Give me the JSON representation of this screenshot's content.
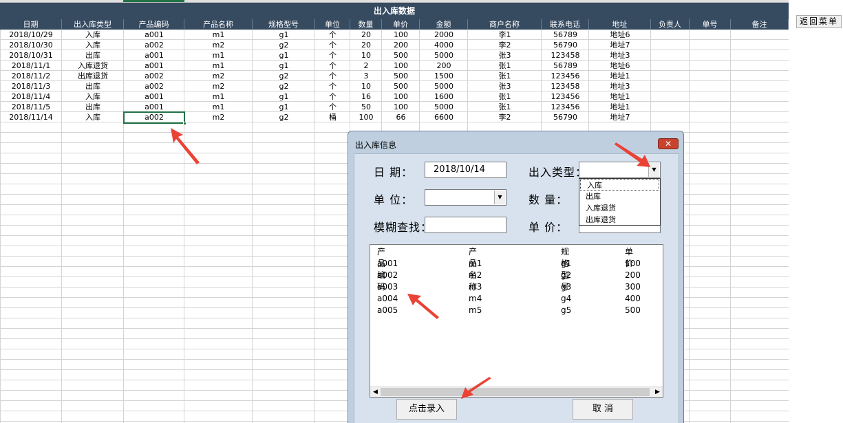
{
  "sheet": {
    "title": "出入库数据",
    "columns": [
      "日期",
      "出入库类型",
      "产品编码",
      "产品名称",
      "规格型号",
      "单位",
      "数量",
      "单价",
      "金额",
      "商户名称",
      "联系电话",
      "地址",
      "负责人",
      "单号",
      "备注"
    ],
    "rows": [
      [
        "2018/10/29",
        "入库",
        "a001",
        "m1",
        "g1",
        "个",
        "20",
        "100",
        "2000",
        "李1",
        "56789",
        "地址6",
        "",
        "",
        ""
      ],
      [
        "2018/10/30",
        "入库",
        "a002",
        "m2",
        "g2",
        "个",
        "20",
        "200",
        "4000",
        "李2",
        "56790",
        "地址7",
        "",
        "",
        ""
      ],
      [
        "2018/10/31",
        "出库",
        "a001",
        "m1",
        "g1",
        "个",
        "10",
        "500",
        "5000",
        "张3",
        "123458",
        "地址3",
        "",
        "",
        ""
      ],
      [
        "2018/11/1",
        "入库退货",
        "a001",
        "m1",
        "g1",
        "个",
        "2",
        "100",
        "200",
        "张1",
        "56789",
        "地址6",
        "",
        "",
        ""
      ],
      [
        "2018/11/2",
        "出库退货",
        "a002",
        "m2",
        "g2",
        "个",
        "3",
        "500",
        "1500",
        "张1",
        "123456",
        "地址1",
        "",
        "",
        ""
      ],
      [
        "2018/11/3",
        "出库",
        "a002",
        "m2",
        "g2",
        "个",
        "10",
        "500",
        "5000",
        "张3",
        "123458",
        "地址3",
        "",
        "",
        ""
      ],
      [
        "2018/11/4",
        "入库",
        "a001",
        "m1",
        "g1",
        "个",
        "16",
        "100",
        "1600",
        "张1",
        "123456",
        "地址1",
        "",
        "",
        ""
      ],
      [
        "2018/11/5",
        "出库",
        "a001",
        "m1",
        "g1",
        "个",
        "50",
        "100",
        "5000",
        "张1",
        "123456",
        "地址1",
        "",
        "",
        ""
      ],
      [
        "2018/11/14",
        "入库",
        "a002",
        "m2",
        "g2",
        "桶",
        "100",
        "66",
        "6600",
        "李2",
        "56790",
        "地址7",
        "",
        "",
        ""
      ]
    ]
  },
  "return_button": "返回菜单",
  "dialog": {
    "title": "出入库信息",
    "close_label": "✕",
    "date_label": "日  期：",
    "date_value": "2018/10/14",
    "type_label": "出入类型：",
    "type_value": "",
    "unit_label": "单  位：",
    "unit_value": "",
    "qty_label": "数  量：",
    "search_label": "模糊查找：",
    "search_value": "",
    "price_label": "单  价：",
    "type_options": [
      "入库",
      "出库",
      "入库退货",
      "出库退货"
    ],
    "list_headers": [
      "产品编码",
      "产品名称",
      "规格型号",
      "单价"
    ],
    "list_rows": [
      [
        "a001",
        "m1",
        "g1",
        "100"
      ],
      [
        "a002",
        "m2",
        "g2",
        "200"
      ],
      [
        "a003",
        "m3",
        "g3",
        "300"
      ],
      [
        "a004",
        "m4",
        "g4",
        "400"
      ],
      [
        "a005",
        "m5",
        "g5",
        "500"
      ]
    ],
    "submit_label": "点击录入",
    "cancel_label": "取  消"
  },
  "colors": {
    "header_bg": "#364a60",
    "accent": "#217346",
    "arrow": "#ea4335"
  }
}
